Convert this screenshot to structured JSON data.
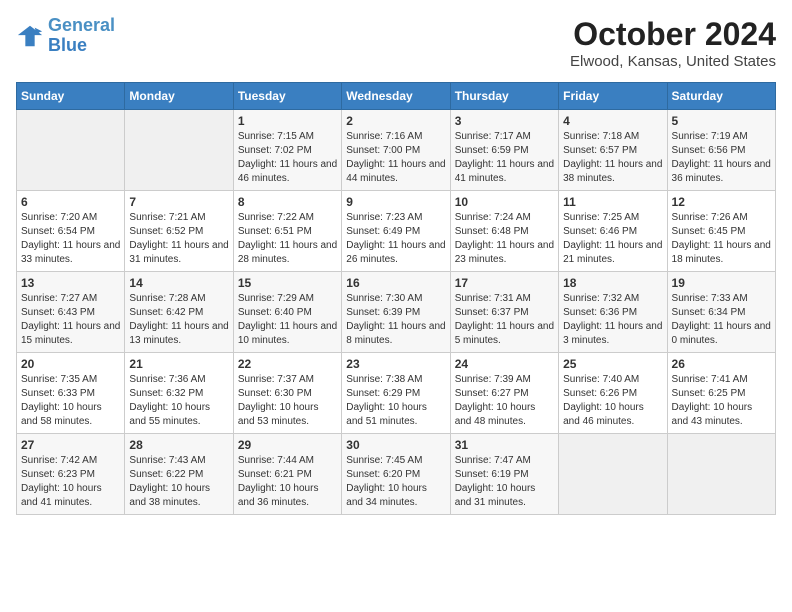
{
  "header": {
    "logo_line1": "General",
    "logo_line2": "Blue",
    "title": "October 2024",
    "subtitle": "Elwood, Kansas, United States"
  },
  "days_of_week": [
    "Sunday",
    "Monday",
    "Tuesday",
    "Wednesday",
    "Thursday",
    "Friday",
    "Saturday"
  ],
  "weeks": [
    [
      {
        "day": "",
        "info": ""
      },
      {
        "day": "",
        "info": ""
      },
      {
        "day": "1",
        "info": "Sunrise: 7:15 AM\nSunset: 7:02 PM\nDaylight: 11 hours and 46 minutes."
      },
      {
        "day": "2",
        "info": "Sunrise: 7:16 AM\nSunset: 7:00 PM\nDaylight: 11 hours and 44 minutes."
      },
      {
        "day": "3",
        "info": "Sunrise: 7:17 AM\nSunset: 6:59 PM\nDaylight: 11 hours and 41 minutes."
      },
      {
        "day": "4",
        "info": "Sunrise: 7:18 AM\nSunset: 6:57 PM\nDaylight: 11 hours and 38 minutes."
      },
      {
        "day": "5",
        "info": "Sunrise: 7:19 AM\nSunset: 6:56 PM\nDaylight: 11 hours and 36 minutes."
      }
    ],
    [
      {
        "day": "6",
        "info": "Sunrise: 7:20 AM\nSunset: 6:54 PM\nDaylight: 11 hours and 33 minutes."
      },
      {
        "day": "7",
        "info": "Sunrise: 7:21 AM\nSunset: 6:52 PM\nDaylight: 11 hours and 31 minutes."
      },
      {
        "day": "8",
        "info": "Sunrise: 7:22 AM\nSunset: 6:51 PM\nDaylight: 11 hours and 28 minutes."
      },
      {
        "day": "9",
        "info": "Sunrise: 7:23 AM\nSunset: 6:49 PM\nDaylight: 11 hours and 26 minutes."
      },
      {
        "day": "10",
        "info": "Sunrise: 7:24 AM\nSunset: 6:48 PM\nDaylight: 11 hours and 23 minutes."
      },
      {
        "day": "11",
        "info": "Sunrise: 7:25 AM\nSunset: 6:46 PM\nDaylight: 11 hours and 21 minutes."
      },
      {
        "day": "12",
        "info": "Sunrise: 7:26 AM\nSunset: 6:45 PM\nDaylight: 11 hours and 18 minutes."
      }
    ],
    [
      {
        "day": "13",
        "info": "Sunrise: 7:27 AM\nSunset: 6:43 PM\nDaylight: 11 hours and 15 minutes."
      },
      {
        "day": "14",
        "info": "Sunrise: 7:28 AM\nSunset: 6:42 PM\nDaylight: 11 hours and 13 minutes."
      },
      {
        "day": "15",
        "info": "Sunrise: 7:29 AM\nSunset: 6:40 PM\nDaylight: 11 hours and 10 minutes."
      },
      {
        "day": "16",
        "info": "Sunrise: 7:30 AM\nSunset: 6:39 PM\nDaylight: 11 hours and 8 minutes."
      },
      {
        "day": "17",
        "info": "Sunrise: 7:31 AM\nSunset: 6:37 PM\nDaylight: 11 hours and 5 minutes."
      },
      {
        "day": "18",
        "info": "Sunrise: 7:32 AM\nSunset: 6:36 PM\nDaylight: 11 hours and 3 minutes."
      },
      {
        "day": "19",
        "info": "Sunrise: 7:33 AM\nSunset: 6:34 PM\nDaylight: 11 hours and 0 minutes."
      }
    ],
    [
      {
        "day": "20",
        "info": "Sunrise: 7:35 AM\nSunset: 6:33 PM\nDaylight: 10 hours and 58 minutes."
      },
      {
        "day": "21",
        "info": "Sunrise: 7:36 AM\nSunset: 6:32 PM\nDaylight: 10 hours and 55 minutes."
      },
      {
        "day": "22",
        "info": "Sunrise: 7:37 AM\nSunset: 6:30 PM\nDaylight: 10 hours and 53 minutes."
      },
      {
        "day": "23",
        "info": "Sunrise: 7:38 AM\nSunset: 6:29 PM\nDaylight: 10 hours and 51 minutes."
      },
      {
        "day": "24",
        "info": "Sunrise: 7:39 AM\nSunset: 6:27 PM\nDaylight: 10 hours and 48 minutes."
      },
      {
        "day": "25",
        "info": "Sunrise: 7:40 AM\nSunset: 6:26 PM\nDaylight: 10 hours and 46 minutes."
      },
      {
        "day": "26",
        "info": "Sunrise: 7:41 AM\nSunset: 6:25 PM\nDaylight: 10 hours and 43 minutes."
      }
    ],
    [
      {
        "day": "27",
        "info": "Sunrise: 7:42 AM\nSunset: 6:23 PM\nDaylight: 10 hours and 41 minutes."
      },
      {
        "day": "28",
        "info": "Sunrise: 7:43 AM\nSunset: 6:22 PM\nDaylight: 10 hours and 38 minutes."
      },
      {
        "day": "29",
        "info": "Sunrise: 7:44 AM\nSunset: 6:21 PM\nDaylight: 10 hours and 36 minutes."
      },
      {
        "day": "30",
        "info": "Sunrise: 7:45 AM\nSunset: 6:20 PM\nDaylight: 10 hours and 34 minutes."
      },
      {
        "day": "31",
        "info": "Sunrise: 7:47 AM\nSunset: 6:19 PM\nDaylight: 10 hours and 31 minutes."
      },
      {
        "day": "",
        "info": ""
      },
      {
        "day": "",
        "info": ""
      }
    ]
  ]
}
